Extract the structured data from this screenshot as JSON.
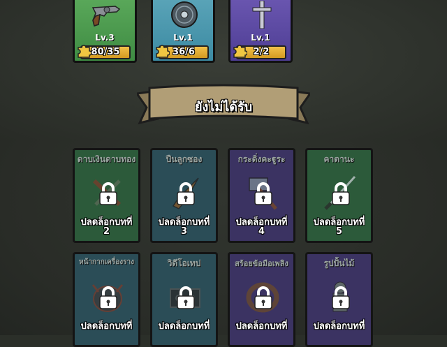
{
  "owned_cards": [
    {
      "level": "Lv.3",
      "progress": "80/35",
      "item_icon": "revolver-icon",
      "color": "#4f9e52"
    },
    {
      "level": "Lv.1",
      "progress": "36/6",
      "item_icon": "vinyl-disc-icon",
      "color": "#4a98ae"
    },
    {
      "level": "Lv.1",
      "progress": "2/2",
      "item_icon": "cross-icon",
      "color": "#5c4aa4"
    }
  ],
  "section_title": "ยังไม่ได้รับ",
  "locked_cards": [
    {
      "name": "ดาบเงินดาบทอง",
      "unlock_label": "ปลดล็อกบทที่",
      "chapter": "2",
      "color": "green",
      "item_icon": "sword-icon"
    },
    {
      "name": "ปืนลูกซอง",
      "unlock_label": "ปลดล็อกบทที่",
      "chapter": "3",
      "color": "blue",
      "item_icon": "shotgun-icon"
    },
    {
      "name": "กระดิ่งคะฐูระ",
      "unlock_label": "ปลดล็อกบทที่",
      "chapter": "4",
      "color": "purple",
      "item_icon": "hammer-bell-icon"
    },
    {
      "name": "คาตานะ",
      "unlock_label": "ปลดล็อกบทที่",
      "chapter": "5",
      "color": "green",
      "item_icon": "katana-icon"
    },
    {
      "name": "หน้ากากเครื่องราง",
      "unlock_label": "ปลดล็อกบทที่",
      "chapter": "",
      "color": "blue",
      "item_icon": "mask-icon"
    },
    {
      "name": "วิดีโอเทป",
      "unlock_label": "ปลดล็อกบทที่",
      "chapter": "",
      "color": "blue",
      "item_icon": "videotape-icon"
    },
    {
      "name": "สร้อยข้อมือเพลิง",
      "unlock_label": "ปลดล็อกบทที่",
      "chapter": "",
      "color": "purple",
      "item_icon": "bracelet-icon"
    },
    {
      "name": "รูปปั้นไม้",
      "unlock_label": "ปลดล็อกบทที่",
      "chapter": "",
      "color": "purple",
      "item_icon": "statue-icon"
    }
  ]
}
